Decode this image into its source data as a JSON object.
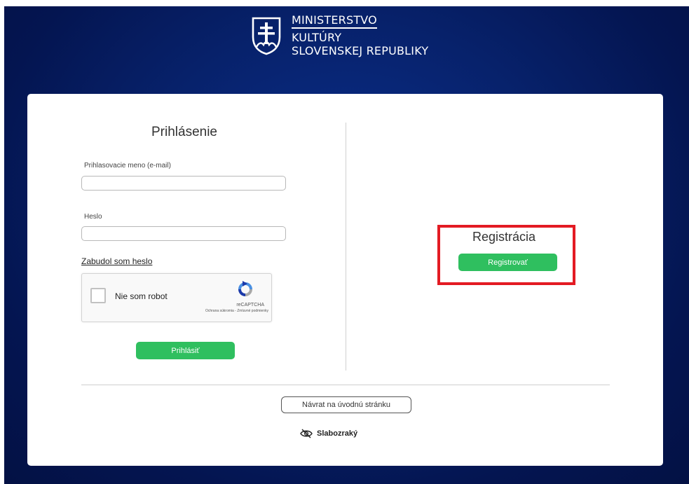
{
  "header": {
    "logo_line1": "MINISTERSTVO",
    "logo_line2": "KULTÚRY",
    "logo_line3": "SLOVENSKEJ REPUBLIKY",
    "crest_icon": "slovak-double-cross-crest-icon"
  },
  "login": {
    "title": "Prihlásenie",
    "username_label": "Prihlasovacie meno (e-mail)",
    "username_value": "",
    "password_label": "Heslo",
    "password_value": "",
    "forgot_password_link": "Zabudol som heslo",
    "captcha_label": "Nie som robot",
    "captcha_brand": "reCAPTCHA",
    "captcha_terms": "Ochrana súkromia - Zmluvné podmienky",
    "captcha_icon": "recaptcha-logo-icon",
    "submit_label": "Prihlásiť"
  },
  "registration": {
    "title": "Registrácia",
    "register_label": "Registrovať"
  },
  "footer": {
    "home_button_label": "Návrat na úvodnú stránku",
    "low_vision_label": "Slabozraký",
    "low_vision_icon": "eye-slash-icon"
  },
  "colors": {
    "background_navy": "#07216a",
    "button_green": "#2fbf5f",
    "highlight_red": "#e31b23"
  }
}
